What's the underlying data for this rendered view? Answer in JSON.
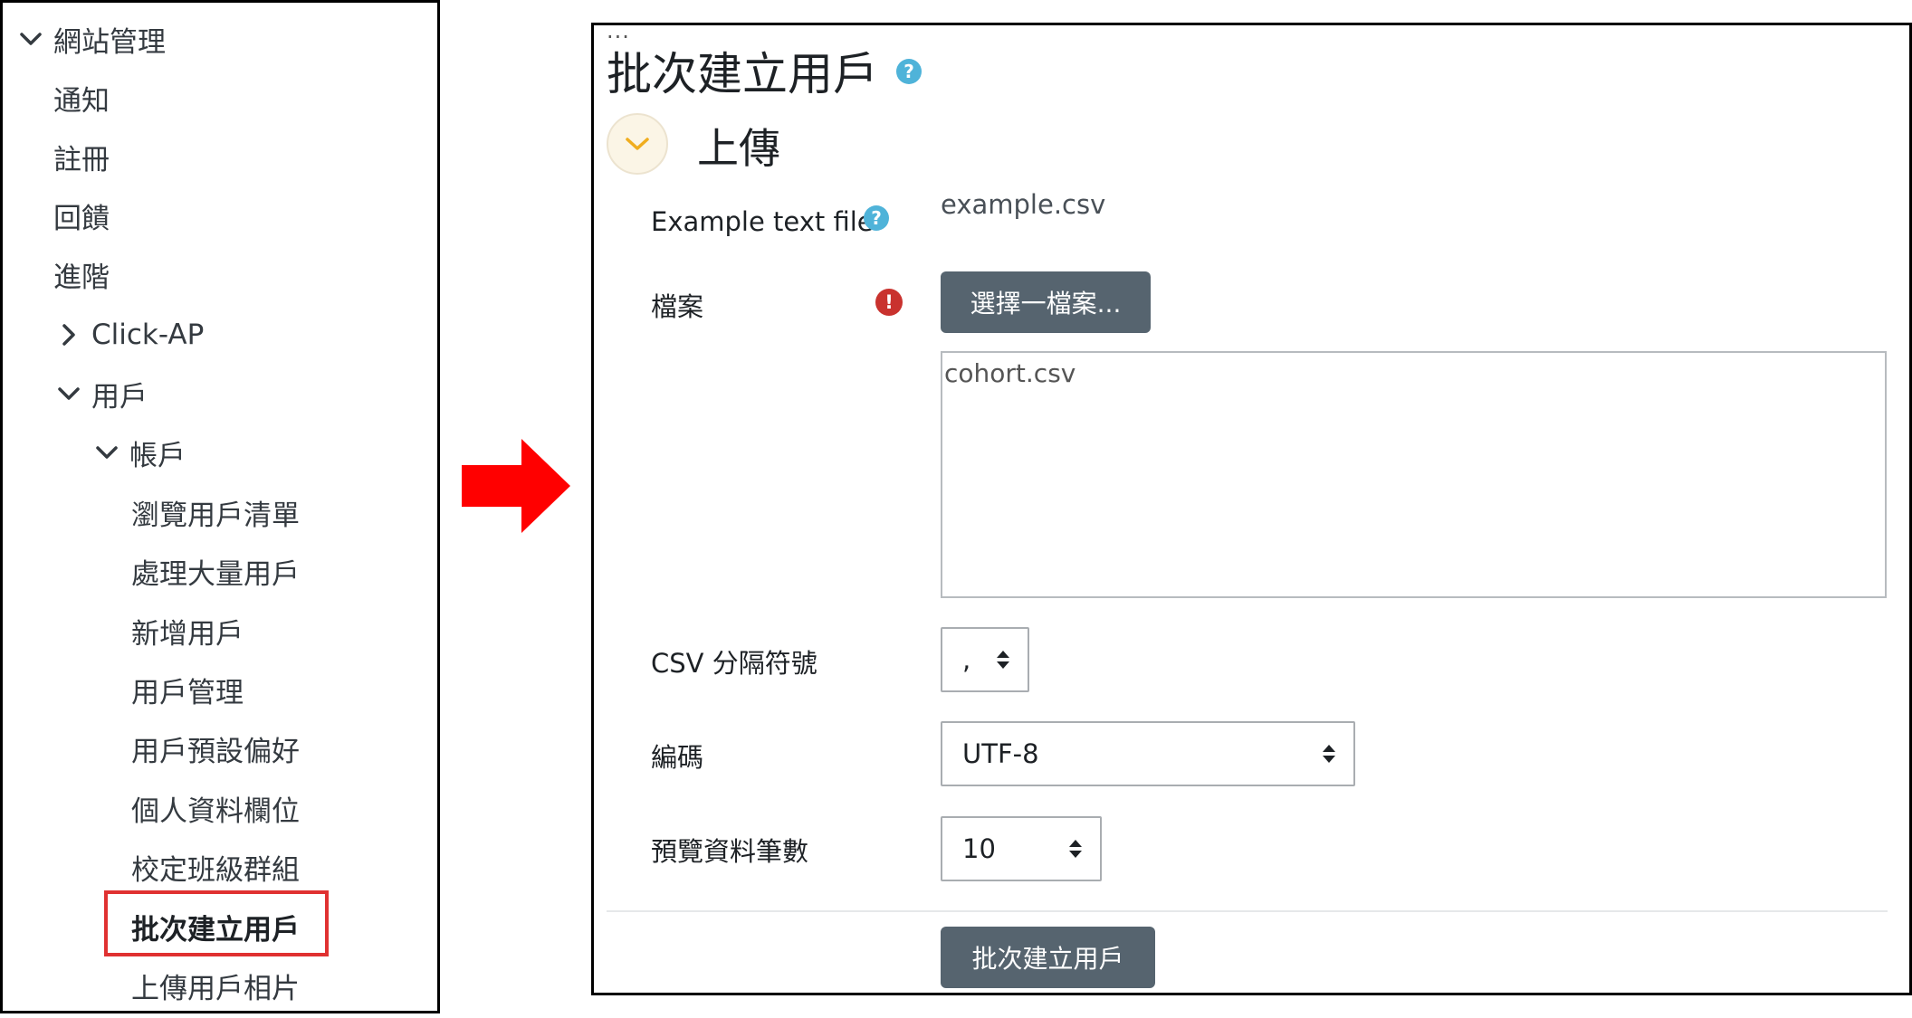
{
  "nav": {
    "site_admin": "網站管理",
    "notifications": "通知",
    "registration": "註冊",
    "feedback": "回饋",
    "advanced": "進階",
    "click_ap": "Click-AP",
    "users": "用戶",
    "accounts": "帳戶",
    "items": [
      "瀏覽用戶清單",
      "處理大量用戶",
      "新增用戶",
      "用戶管理",
      "用戶預設偏好",
      "個人資料欄位",
      "校定班級群組",
      "批次建立用戶",
      "上傳用戶相片"
    ],
    "active_index": 7
  },
  "form": {
    "dots": "...",
    "title": "批次建立用戶",
    "section": "上傳",
    "example_label": "Example text file",
    "example_value": "example.csv",
    "file_label": "檔案",
    "choose_file_button": "選擇一檔案...",
    "selected_file": "cohort.csv",
    "csv_delimiter_label": "CSV 分隔符號",
    "csv_delimiter_value": ",",
    "encoding_label": "編碼",
    "encoding_value": "UTF-8",
    "preview_rows_label": "預覽資料筆數",
    "preview_rows_value": "10",
    "submit_button": "批次建立用戶"
  },
  "colors": {
    "help": "#4fb3d9",
    "required": "#c9322e",
    "button": "#56646f",
    "highlight": "#e03131",
    "arrow": "#ff0000"
  },
  "icons": {
    "help": "?",
    "required": "!"
  }
}
